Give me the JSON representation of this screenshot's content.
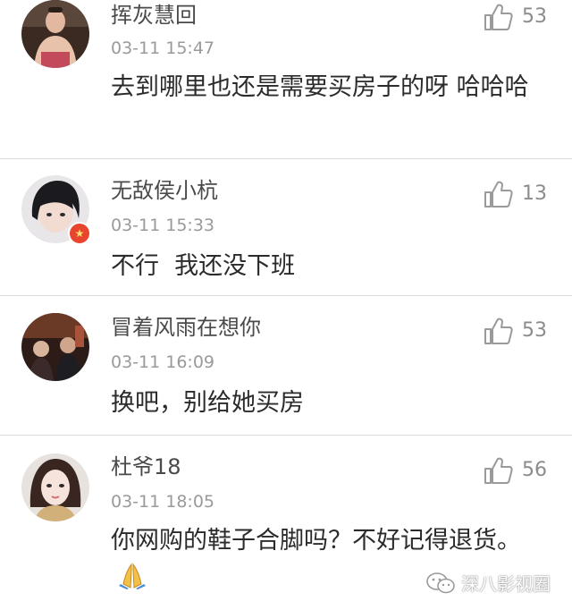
{
  "comments": [
    {
      "username": "挥灰慧回",
      "timestamp": "03-11 15:47",
      "text": "去到哪里也还是需要买房子的呀 哈哈哈",
      "likes": "53",
      "avatar_icon": "user-avatar",
      "has_badge": false
    },
    {
      "username": "无敌侯小杭",
      "timestamp": "03-11 15:33",
      "text": "不行  我还没下班",
      "likes": "13",
      "avatar_icon": "user-avatar",
      "has_badge": true
    },
    {
      "username": "冒着风雨在想你",
      "timestamp": "03-11 16:09",
      "text": "换吧，别给她买房",
      "likes": "53",
      "avatar_icon": "user-avatar",
      "has_badge": false
    },
    {
      "username": "杜爷18",
      "timestamp": "03-11 18:05",
      "text": "你网购的鞋子合脚吗？不好记得退货。",
      "likes": "56",
      "avatar_icon": "user-avatar",
      "has_badge": false,
      "trailing_emoji": "folded-hands-emoji"
    }
  ],
  "watermark": {
    "text": "深八影视圈",
    "icon": "wechat-icon"
  },
  "colors": {
    "divider": "#dcdcdc",
    "username": "#4a4a4a",
    "timestamp": "#9a9a9a",
    "badge": "#e8452f"
  }
}
